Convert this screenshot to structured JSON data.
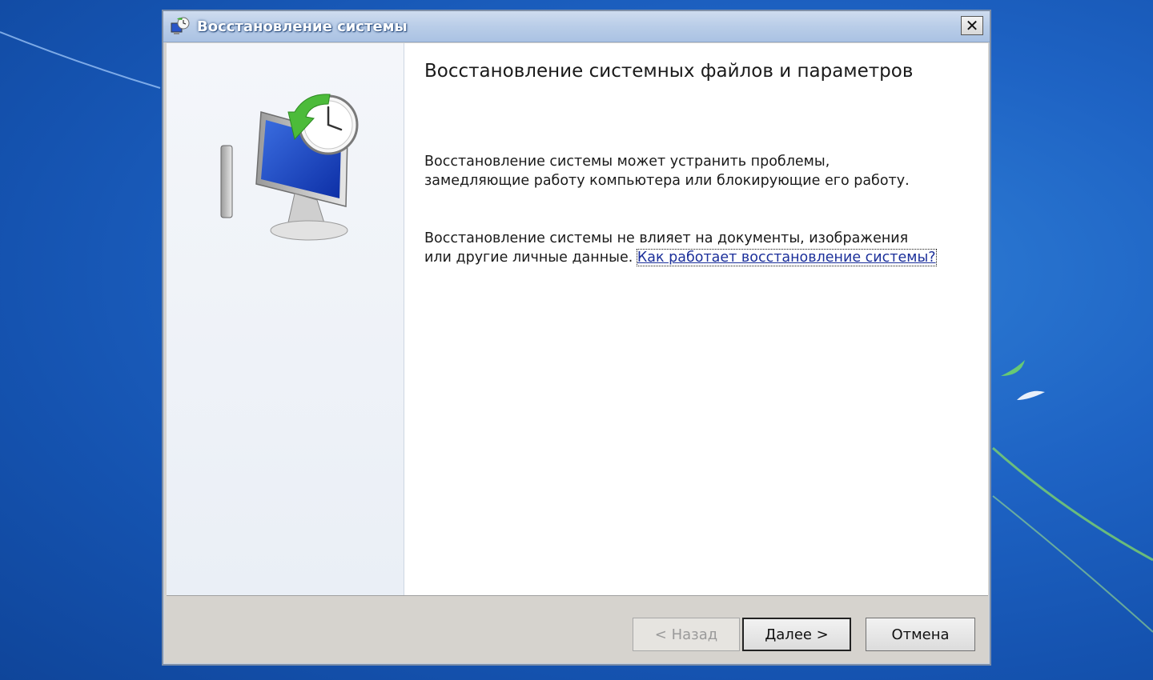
{
  "window": {
    "title": "Восстановление системы",
    "close_label": "✕"
  },
  "content": {
    "heading": "Восстановление системных файлов и параметров",
    "paragraph1": "Восстановление системы может устранить проблемы, замедляющие работу компьютера или блокирующие его работу.",
    "paragraph2": "Восстановление системы не влияет на документы, изображения или другие личные данные.",
    "help_link": "Как работает восстановление системы?"
  },
  "buttons": {
    "back": "< Назад",
    "next": "Далее >",
    "cancel": "Отмена"
  },
  "icons": {
    "title": "system-restore-icon",
    "illustration": "system-restore-illustration"
  },
  "colors": {
    "desktop": "#1e63c4",
    "link": "#1b2f9a",
    "button_face": "#dcdcdc"
  }
}
